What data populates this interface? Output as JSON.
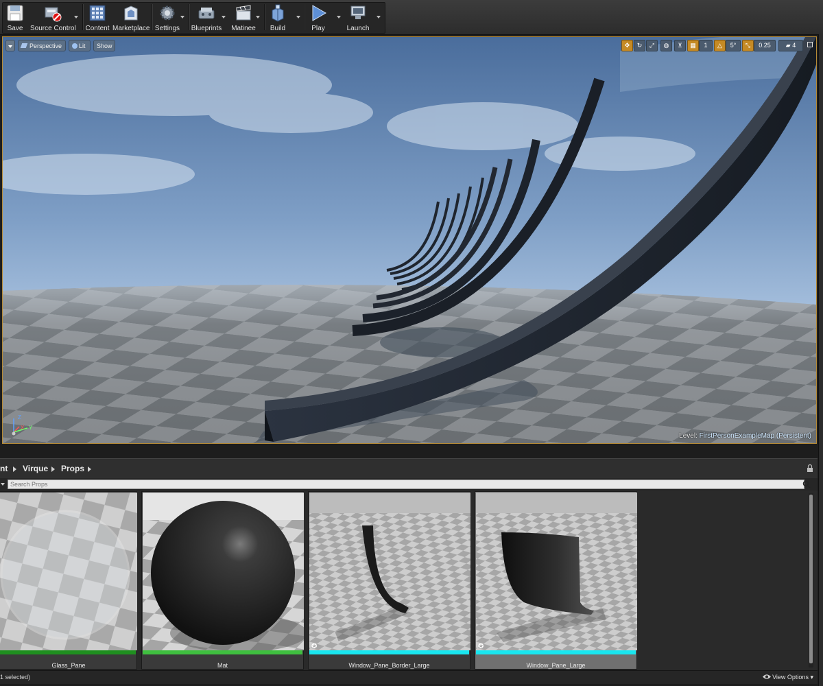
{
  "toolbar": {
    "buttons": [
      {
        "label": "Save",
        "icon": "save-icon"
      },
      {
        "label": "Source Control",
        "icon": "source-control-icon"
      },
      {
        "label": "Content",
        "icon": "content-icon"
      },
      {
        "label": "Marketplace",
        "icon": "marketplace-icon"
      },
      {
        "label": "Settings",
        "icon": "settings-icon"
      },
      {
        "label": "Blueprints",
        "icon": "blueprints-icon"
      },
      {
        "label": "Matinee",
        "icon": "matinee-icon"
      },
      {
        "label": "Build",
        "icon": "build-icon"
      },
      {
        "label": "Play",
        "icon": "play-icon"
      },
      {
        "label": "Launch",
        "icon": "launch-icon"
      }
    ]
  },
  "viewport": {
    "view_mode": "Perspective",
    "lighting": "Lit",
    "show": "Show",
    "grid_snap": "",
    "rotation_snap": "5°",
    "scale_snap": "0.25",
    "camera_speed": "4",
    "layer_value": "1",
    "level_prefix": "Level:",
    "level_name": "FirstPersonExampleMap (Persistent)",
    "axis_z": "Z",
    "axis_x": "X",
    "axis_y": "Y"
  },
  "content_browser": {
    "breadcrumbs": [
      "nt",
      "Virque",
      "Props"
    ],
    "search_placeholder": "Search Props",
    "assets": [
      {
        "name": "Glass_Pane",
        "type_color": "#1f8f1f",
        "selected": false
      },
      {
        "name": "Mat",
        "type_color": "#3fbf3f",
        "selected": false
      },
      {
        "name": "Window_Pane_Border_Large",
        "type_color": "#19e6ef",
        "selected": false
      },
      {
        "name": "Window_Pane_Large",
        "type_color": "#19e6ef",
        "selected": true
      }
    ],
    "status": "1 selected)",
    "view_options": "View Options"
  },
  "colors": {
    "accent_orange": "#c58a25",
    "static_mesh": "#19e6ef",
    "material": "#3fbf3f",
    "viewport_border": "#b58a36"
  }
}
